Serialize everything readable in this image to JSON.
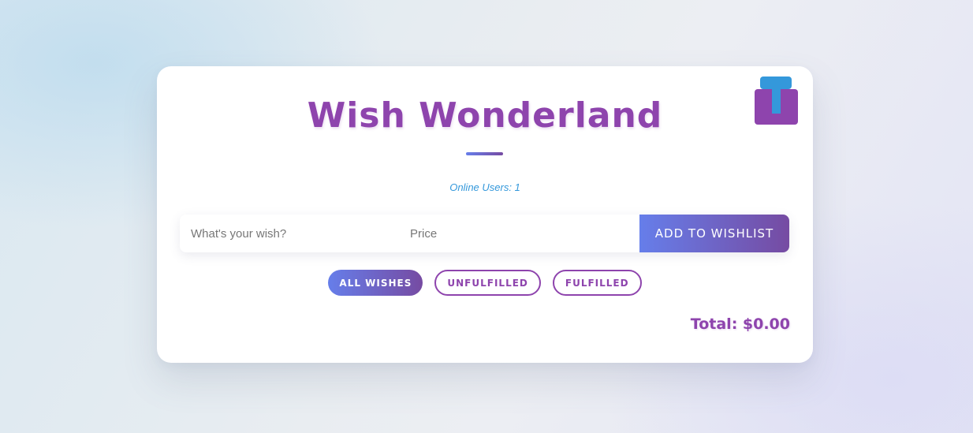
{
  "header": {
    "title": "Wish Wonderland",
    "online_users": "Online Users: 1"
  },
  "form": {
    "wish_placeholder": "What's your wish?",
    "wish_value": "",
    "price_placeholder": "Price",
    "price_value": "",
    "add_button_label": "ADD TO WISHLIST"
  },
  "filters": [
    {
      "label": "ALL WISHES",
      "active": true
    },
    {
      "label": "UNFULFILLED",
      "active": false
    },
    {
      "label": "FULFILLED",
      "active": false
    }
  ],
  "summary": {
    "total": "Total: $0.00"
  },
  "icons": {
    "corner_icon": "gift-icon"
  },
  "colors": {
    "primary_purple": "#8e44ad",
    "accent_blue": "#3498db",
    "gradient_start": "#667eea",
    "gradient_end": "#764ba2"
  }
}
